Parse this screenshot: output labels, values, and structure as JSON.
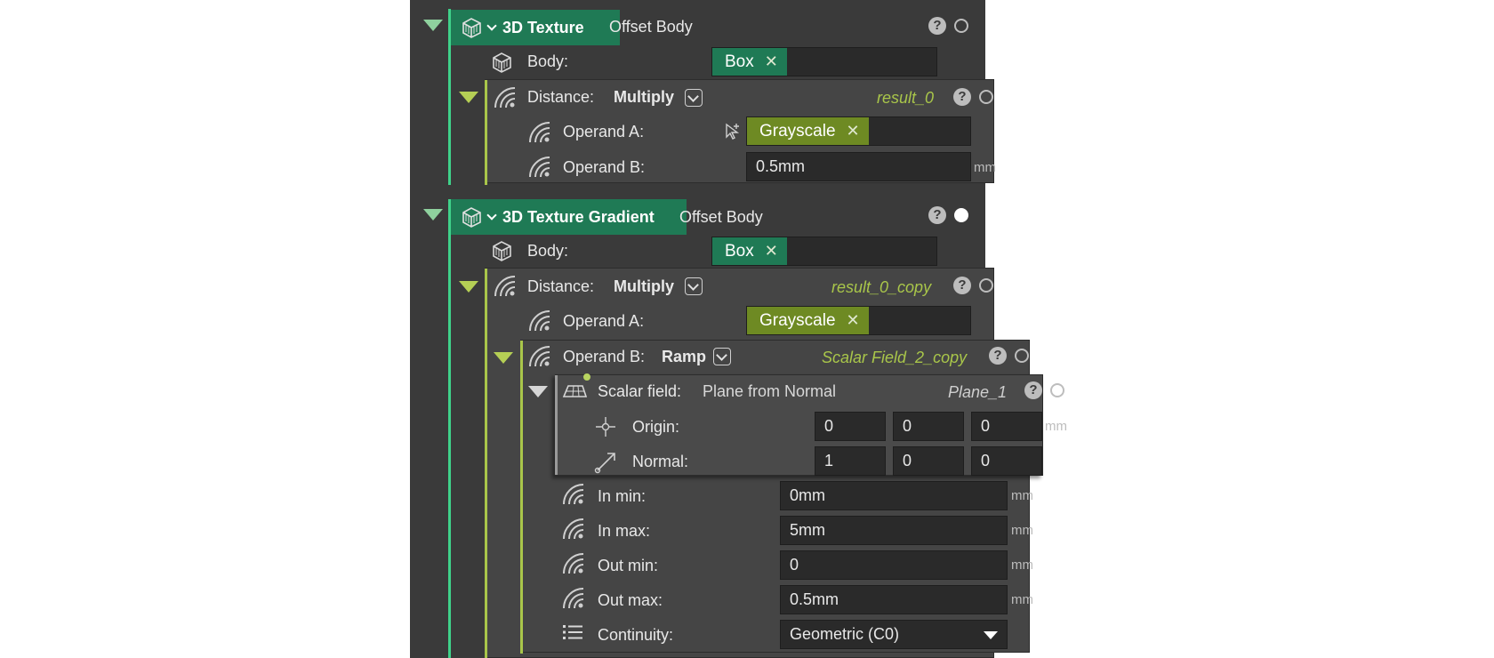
{
  "node1": {
    "title": "3D Texture",
    "target": "Offset Body",
    "body_label": "Body:",
    "body_tag": "Box",
    "distance": {
      "label": "Distance:",
      "op": "Multiply",
      "result": "result_0",
      "operand_a_label": "Operand A:",
      "operand_a_tag": "Grayscale",
      "operand_b_label": "Operand B:",
      "operand_b_value": "0.5mm",
      "operand_b_unit": "mm"
    }
  },
  "node2": {
    "title": "3D Texture Gradient",
    "target": "Offset Body",
    "body_label": "Body:",
    "body_tag": "Box",
    "distance": {
      "label": "Distance:",
      "op": "Multiply",
      "result": "result_0_copy",
      "operand_a_label": "Operand A:",
      "operand_a_tag": "Grayscale",
      "operand_b": {
        "label": "Operand B:",
        "op": "Ramp",
        "result": "Scalar Field_2_copy",
        "scalar_field": {
          "label": "Scalar field:",
          "type": "Plane from Normal",
          "result": "Plane_1",
          "origin_label": "Origin:",
          "origin": [
            "0",
            "0",
            "0"
          ],
          "origin_unit": "mm",
          "normal_label": "Normal:",
          "normal": [
            "1",
            "0",
            "0"
          ]
        },
        "in_min_label": "In min:",
        "in_min": "0mm",
        "in_max_label": "In max:",
        "in_max": "5mm",
        "out_min_label": "Out min:",
        "out_min": "0",
        "out_max_label": "Out max:",
        "out_max": "0.5mm",
        "unit": "mm",
        "continuity_label": "Continuity:",
        "continuity": "Geometric (C0)"
      }
    }
  },
  "common": {
    "close_glyph": "✕",
    "help_glyph": "?"
  },
  "colors": {
    "panel": "#3a3a3a",
    "accent_green": "#3fd28a",
    "accent_olive": "#a9c64a",
    "header_teal": "#1f7a55"
  },
  "icons": [
    "box-body-icon",
    "field-waves-icon",
    "origin-icon",
    "normal-arrow-icon",
    "plane-icon",
    "list-icon",
    "pointer-icon"
  ]
}
